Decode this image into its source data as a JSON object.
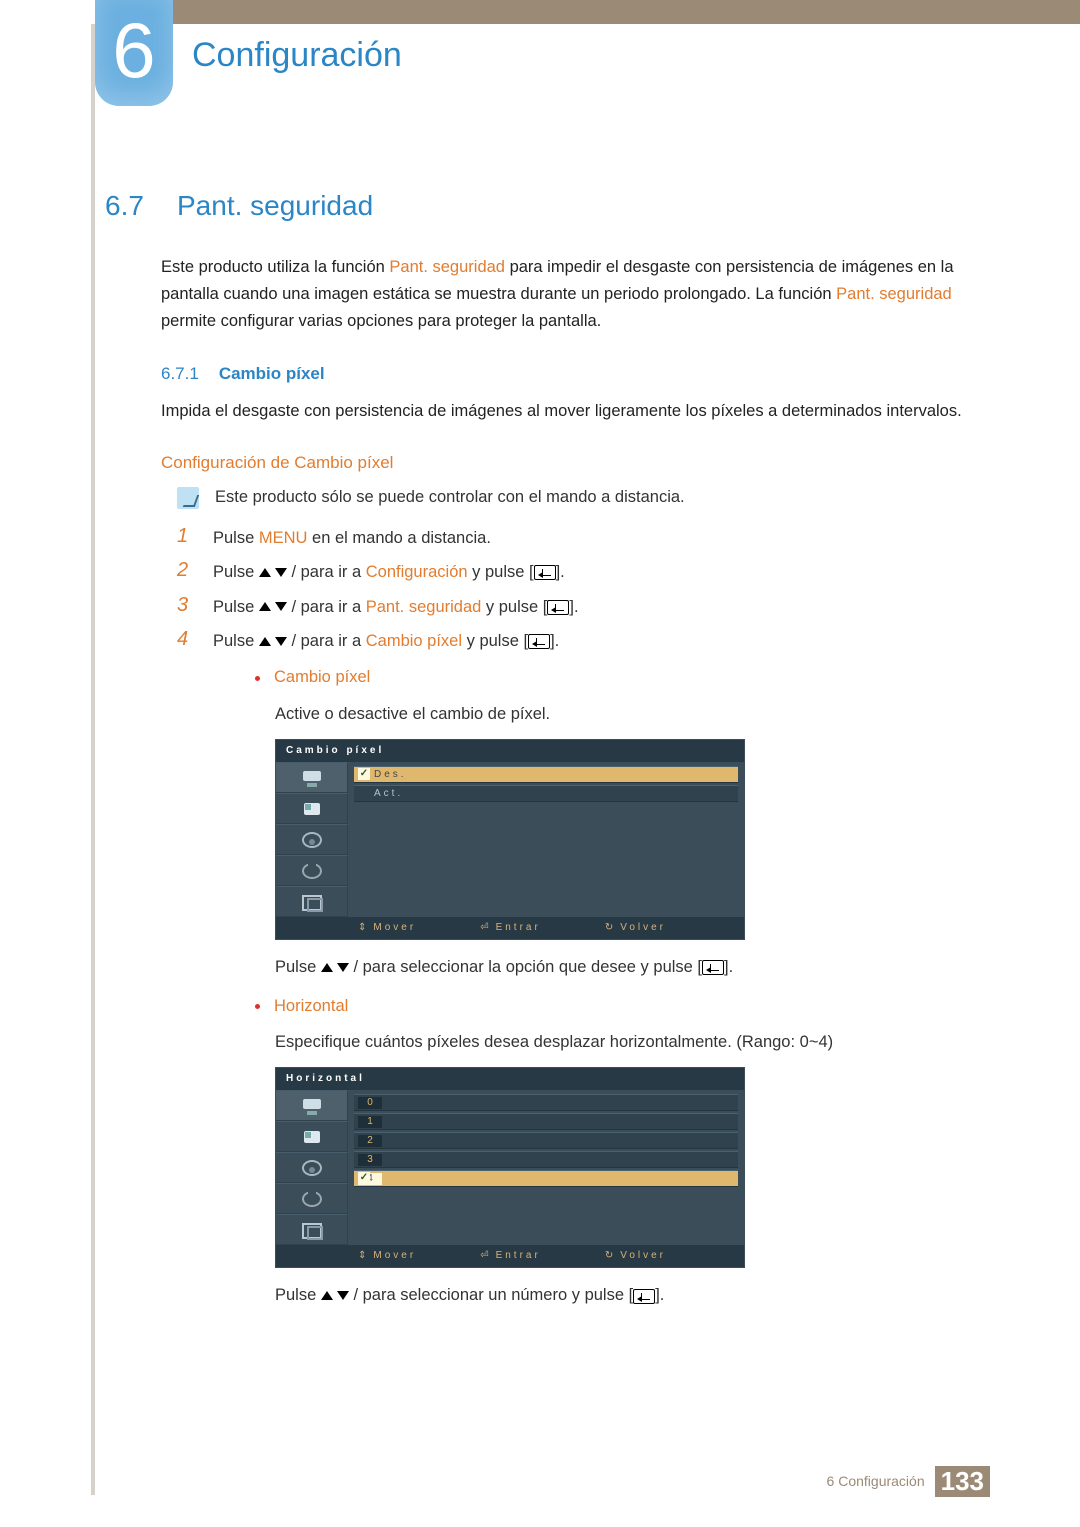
{
  "chapter": {
    "number": "6",
    "title": "Configuración"
  },
  "section": {
    "number": "6.7",
    "title": "Pant. seguridad"
  },
  "intro": {
    "text_a": "Este producto utiliza la función ",
    "hi_a": "Pant. seguridad",
    "text_b": " para impedir el desgaste con persistencia de imágenes en la pantalla cuando una imagen estática se muestra durante un periodo prolongado. La función ",
    "hi_b": "Pant. seguridad",
    "text_c": " permite configurar varias opciones para proteger la pantalla."
  },
  "sub671": {
    "number": "6.7.1",
    "title": "Cambio píxel"
  },
  "sub671_body": "Impida el desgaste con persistencia de imágenes al mover ligeramente los píxeles a determinados intervalos.",
  "config_heading": "Configuración de Cambio píxel",
  "note": "Este producto sólo se puede controlar con el mando a distancia.",
  "steps": {
    "s1a": "Pulse ",
    "s1hi": "MENU",
    "s1b": " en el mando a distancia.",
    "s2a": "Pulse ",
    "s2b": " para ir a ",
    "s2hi": "Configuración",
    "s2c": " y pulse [",
    "s2d": "].",
    "s3a": "Pulse ",
    "s3b": " para ir a ",
    "s3hi": "Pant. seguridad",
    "s3c": " y pulse [",
    "s3d": "].",
    "s4a": "Pulse ",
    "s4b": " para ir a ",
    "s4hi": "Cambio píxel",
    "s4c": " y pulse [",
    "s4d": "]."
  },
  "bullet_cp": {
    "title": "Cambio píxel",
    "body": "Active o desactive el cambio de píxel.",
    "after_a": "Pulse ",
    "after_b": " para seleccionar la opción que desee y pulse [",
    "after_c": "]."
  },
  "osd1": {
    "title": "Cambio píxel",
    "rows": {
      "r1": "Des.",
      "r2": "Act."
    },
    "foot": {
      "move": "Mover",
      "enter": "Entrar",
      "return": "Volver"
    }
  },
  "bullet_hz": {
    "title": "Horizontal",
    "body": "Especifique cuántos píxeles desea desplazar horizontalmente. (Rango: 0~4)",
    "after_a": "Pulse ",
    "after_b": " para seleccionar un número y pulse [",
    "after_c": "]."
  },
  "osd2": {
    "title": "Horizontal",
    "rows": [
      "0",
      "1",
      "2",
      "3",
      "4"
    ],
    "foot": {
      "move": "Mover",
      "enter": "Entrar",
      "return": "Volver"
    }
  },
  "footer": {
    "chapter_ref": "6 Configuración",
    "page": "133"
  }
}
